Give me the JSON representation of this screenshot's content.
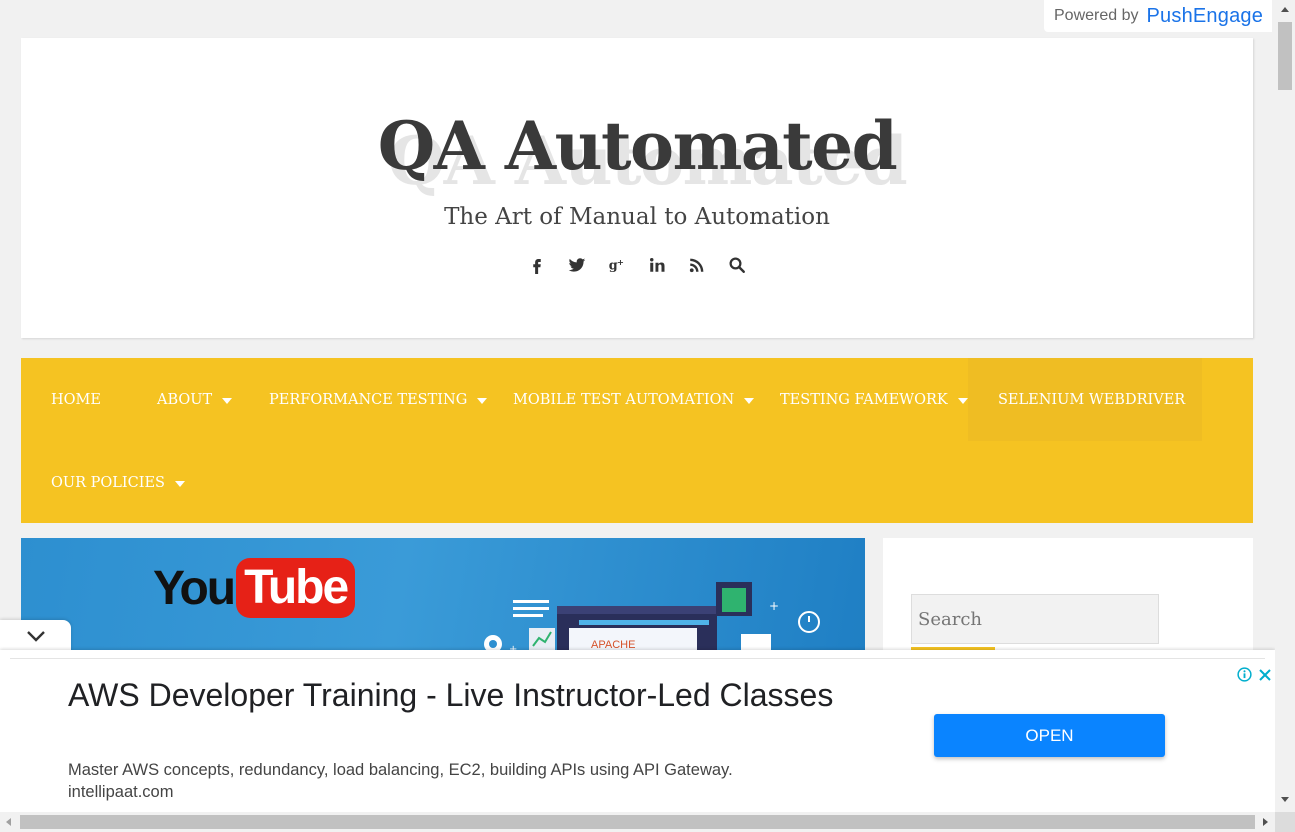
{
  "powered": {
    "by": "Powered by",
    "brand": "PushEngage"
  },
  "header": {
    "title": "QA Automated",
    "description": "The Art of Manual to Automation",
    "social_icons": [
      "facebook-icon",
      "twitter-icon",
      "google-plus-icon",
      "linkedin-icon",
      "rss-icon",
      "search-icon"
    ]
  },
  "nav": {
    "items": [
      {
        "label": "HOME",
        "has_submenu": false
      },
      {
        "label": "ABOUT",
        "has_submenu": true
      },
      {
        "label": "PERFORMANCE TESTING",
        "has_submenu": true
      },
      {
        "label": "MOBILE TEST AUTOMATION",
        "has_submenu": true
      },
      {
        "label": "TESTING FAMEWORK",
        "has_submenu": true
      },
      {
        "label": "SELENIUM WEBDRIVER",
        "has_submenu": false,
        "active": true
      },
      {
        "label": "OUR POLICIES",
        "has_submenu": true
      }
    ]
  },
  "featured": {
    "logo_you": "You",
    "logo_tube": "Tube",
    "badge": "APACHE"
  },
  "sidebar": {
    "search_placeholder": "Search"
  },
  "ad": {
    "title": "AWS Developer Training - Live Instructor-Led Classes",
    "description": "Master AWS concepts, redundancy, load balancing, EC2, building APIs using API Gateway.",
    "url": "intellipaat.com",
    "cta": "OPEN"
  },
  "colors": {
    "nav_bg": "#f5c322",
    "nav_active": "#efbd23",
    "brand_blue": "#1a73e8",
    "ad_button": "#0a84ff",
    "featured_bg": "#2d8fd0"
  }
}
